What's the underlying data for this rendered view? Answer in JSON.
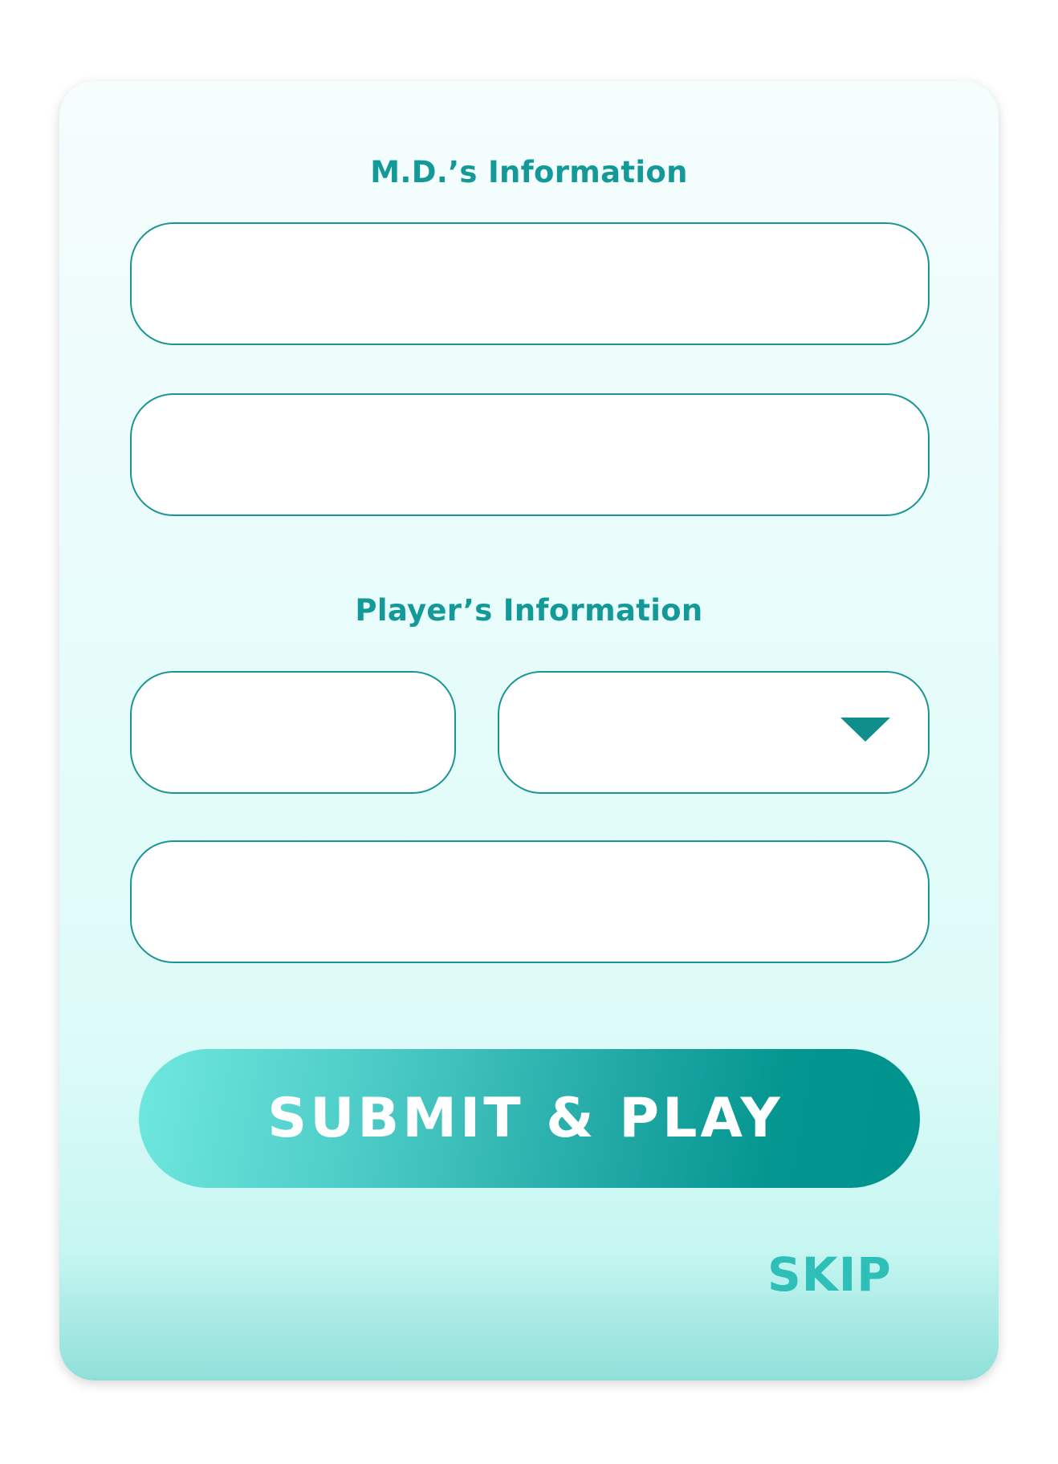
{
  "form": {
    "md_section_title": "M.D.’s Information",
    "md_field_1": {
      "value": "",
      "placeholder": ""
    },
    "md_field_2": {
      "value": "",
      "placeholder": ""
    },
    "player_section_title": "Player’s Information",
    "player_field_1": {
      "value": "",
      "placeholder": ""
    },
    "player_select": {
      "selected": ""
    },
    "player_field_2": {
      "value": "",
      "placeholder": ""
    },
    "submit_label": "SUBMIT & PLAY",
    "skip_label": "SKIP"
  },
  "colors": {
    "accent": "#139a98",
    "border": "#1a9593",
    "button_start": "#6fe8df",
    "button_end": "#00938d",
    "skip": "#2ebfb8"
  },
  "icons": {
    "dropdown": "caret-down-icon"
  }
}
